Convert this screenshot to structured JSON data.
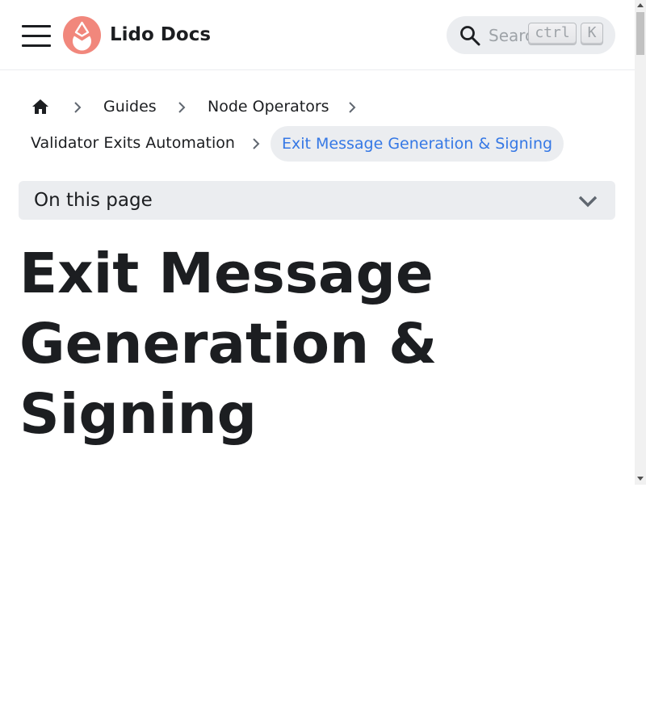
{
  "navbar": {
    "brand": "Lido Docs",
    "search": {
      "placeholder": "Search",
      "shortcut_key1": "ctrl",
      "shortcut_key2": "K"
    },
    "icons": {
      "menu": "hamburger-icon",
      "logo": "lido-logo",
      "search": "search-icon"
    }
  },
  "breadcrumb": {
    "home_icon": "home-icon",
    "items": [
      {
        "label": "Guides"
      },
      {
        "label": "Node Operators"
      },
      {
        "label": "Validator Exits Automation"
      },
      {
        "label": "Exit Message Generation & Signing"
      }
    ]
  },
  "toc": {
    "label": "On this page",
    "icon": "chevron-down-icon"
  },
  "page": {
    "title": "Exit Message Generation & Signing"
  },
  "colors": {
    "text": "#1c1e21",
    "accent": "#3578e5",
    "surface": "#ebedf0",
    "logo_bg": "#f1877c"
  }
}
